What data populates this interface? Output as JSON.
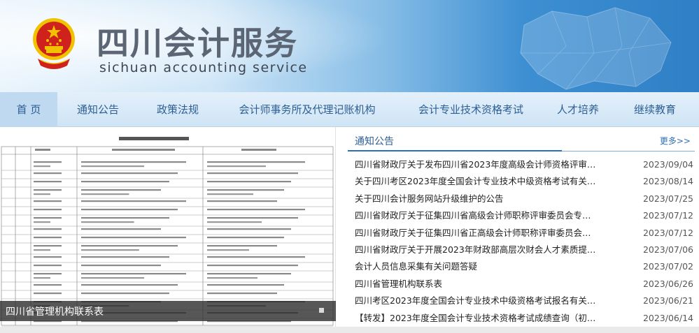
{
  "header": {
    "title": "四川会计服务",
    "subtitle": "sichuan accounting service",
    "emblem_icon": "national-emblem-icon"
  },
  "nav": {
    "items": [
      {
        "label": "首 页",
        "active": true
      },
      {
        "label": "通知公告"
      },
      {
        "label": "政策法规"
      },
      {
        "label": "会计师事务所及代理记账机构"
      },
      {
        "label": "会计专业技术资格考试"
      },
      {
        "label": "人才培养"
      },
      {
        "label": "继续教育"
      }
    ]
  },
  "slideshow": {
    "caption": "四川省管理机构联系表"
  },
  "notices": {
    "tab_label": "通知公告",
    "more_label": "更多>>",
    "items": [
      {
        "title": "四川省财政厅关于发布四川省2023年度高级会计师资格评审使...",
        "date": "2023/09/04"
      },
      {
        "title": "关于四川考区2023年度全国会计专业技术中级资格考试有关事...",
        "date": "2023/08/14"
      },
      {
        "title": "关于四川会计服务网站升级维护的公告",
        "date": "2023/07/25"
      },
      {
        "title": "四川省财政厅关于征集四川省高级会计师职称评审委员会专家...",
        "date": "2023/07/12"
      },
      {
        "title": "四川省财政厅关于征集四川省正高级会计师职称评审委员会专...",
        "date": "2023/07/12"
      },
      {
        "title": "四川省财政厅关于开展2023年财政部高层次财会人才素质提升...",
        "date": "2023/07/06"
      },
      {
        "title": "会计人员信息采集有关问题答疑",
        "date": "2023/07/02"
      },
      {
        "title": "四川省管理机构联系表",
        "date": "2023/06/26"
      },
      {
        "title": "四川考区2023年度全国会计专业技术中级资格考试报名有关问...",
        "date": "2023/06/21"
      },
      {
        "title": "【转发】2023年度全国会计专业技术资格考试成绩查询（初级）",
        "date": "2023/06/14"
      }
    ]
  },
  "colors": {
    "nav_text": "#2d5f95",
    "accent": "#2d6fb4",
    "emblem_red": "#d0221c",
    "emblem_gold": "#f2c200"
  }
}
